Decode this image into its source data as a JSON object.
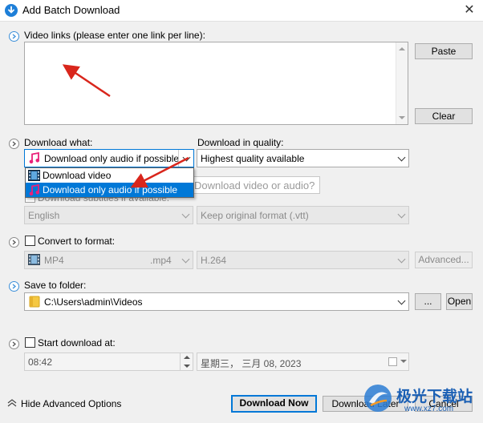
{
  "window": {
    "title": "Add Batch Download",
    "close": "✕"
  },
  "links": {
    "label": "Video links (please enter one link per line):",
    "value": "",
    "paste": "Paste",
    "clear": "Clear"
  },
  "download_what": {
    "label": "Download what:",
    "selected": "Download only audio if possible",
    "options": [
      "Download video",
      "Download only audio if possible"
    ],
    "highlighted_index": 1,
    "hint": "Download video or audio?"
  },
  "quality": {
    "label": "Download in quality:",
    "selected": "Highest quality available"
  },
  "subtitles": {
    "label": "Download subtitles if available:",
    "language": "English",
    "format": "Keep original format (.vtt)"
  },
  "convert": {
    "label": "Convert to format:",
    "format": "MP4",
    "ext": ".mp4",
    "codec": "H.264",
    "advanced": "Advanced..."
  },
  "save": {
    "label": "Save to folder:",
    "path": "C:\\Users\\admin\\Videos",
    "browse": "...",
    "open": "Open"
  },
  "start": {
    "label": "Start download at:",
    "time": "08:42",
    "date": "星期三，  三月  08, 2023"
  },
  "footer": {
    "toggle": "Hide Advanced Options",
    "download_now": "Download Now",
    "download_later": "Download Later",
    "cancel": "Cancel"
  },
  "watermark": {
    "text": "极光下载站",
    "url": "www.xz7.com"
  },
  "colors": {
    "accent": "#0078d7",
    "arrow": "#d9261c",
    "music": "#e9217a"
  }
}
